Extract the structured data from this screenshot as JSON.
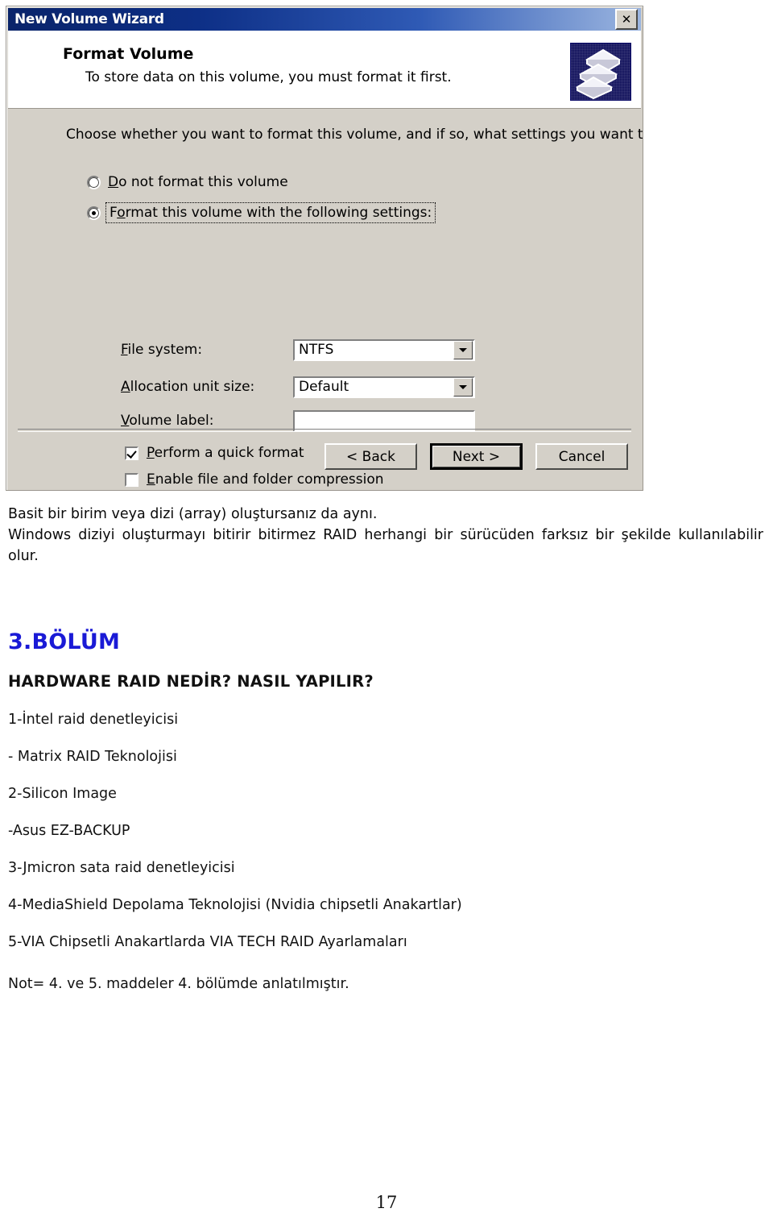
{
  "dialog": {
    "title": "New Volume Wizard",
    "close_label": "✕",
    "header": {
      "title": "Format Volume",
      "subtitle": "To store data on this volume, you must format it first.",
      "icon": "disk-platters-icon"
    },
    "instruction": "Choose whether you want to format this volume, and if so, what settings you want to use.",
    "radios": [
      {
        "label_pre": "D",
        "label_rest": "o not format this volume",
        "checked": false,
        "focused": false
      },
      {
        "label_pre": "F",
        "label_mid": "o",
        "label_rest": "rmat this volume with the following settings:",
        "checked": true,
        "focused": true
      }
    ],
    "fields": [
      {
        "label_pre": "F",
        "label_rest": "ile system:",
        "value": "NTFS",
        "type": "combo"
      },
      {
        "label_pre": "A",
        "label_rest": "llocation unit size:",
        "value": "Default",
        "type": "combo"
      },
      {
        "label_pre": "V",
        "label_rest": "olume label:",
        "value": "",
        "type": "text"
      }
    ],
    "checkboxes": [
      {
        "label_pre": "P",
        "label_rest": "erform a quick format",
        "checked": true
      },
      {
        "label_pre": "E",
        "label_rest": "nable file and folder compression",
        "checked": false
      }
    ],
    "buttons": {
      "back": "< Back",
      "next": "Next >",
      "cancel": "Cancel"
    }
  },
  "document": {
    "paragraph_line1": "Basit bir birim veya dizi (array) oluştursanız da aynı.",
    "paragraph_line2": "Windows diziyi oluşturmayı bitirir bitirmez RAID herhangi bir sürücüden farksız bir şekilde kullanılabilir olur.",
    "chapter": "3.BÖLÜM",
    "chapter_subtitle": "HARDWARE RAID NEDİR? NASIL YAPILIR?",
    "list": [
      "1-İntel raid denetleyicisi",
      "- Matrix RAID Teknolojisi",
      "2-Silicon Image",
      "-Asus EZ-BACKUP",
      "3-Jmicron sata raid denetleyicisi",
      "4-MediaShield Depolama Teknolojisi (Nvidia chipsetli Anakartlar)",
      "5-VIA Chipsetli Anakartlarda VIA TECH RAID Ayarlamaları"
    ],
    "note": "Not= 4. ve 5. maddeler 4. bölümde anlatılmıştır.",
    "page_number": "17"
  },
  "colors": {
    "chapter_blue": "#1a1ad6",
    "titlebar_start": "#0a246a",
    "titlebar_end": "#9cb6e0",
    "dialog_face": "#d4d0c8"
  }
}
